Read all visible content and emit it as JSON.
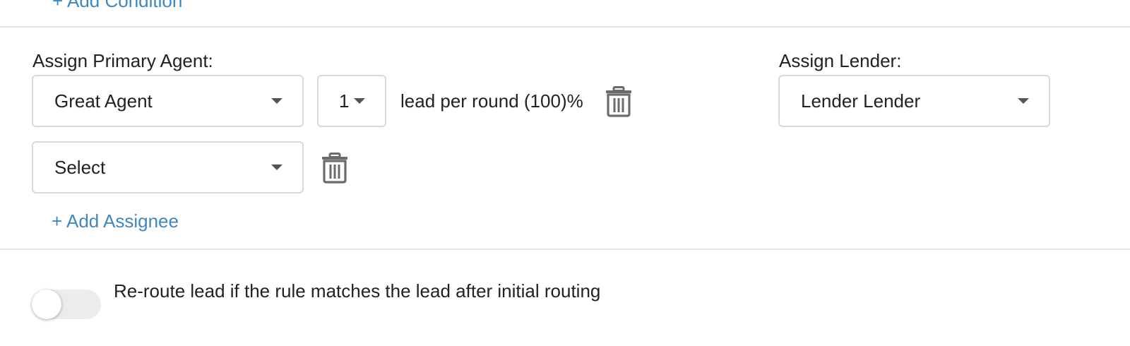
{
  "add_condition_label": "+ Add Condition",
  "primary_agent": {
    "label": "Assign Primary Agent:",
    "rows": [
      {
        "agent": "Great Agent",
        "count": "1",
        "ratio_text": "lead per round (100)%"
      },
      {
        "agent": "Select"
      }
    ],
    "add_assignee_label": "+ Add Assignee"
  },
  "lender": {
    "label": "Assign Lender:",
    "value": "Lender Lender"
  },
  "reroute": {
    "label": "Re-route lead if the rule matches the lead after initial routing",
    "enabled": false
  },
  "colors": {
    "link": "#3f87bf",
    "border": "#d9d9d9",
    "icon": "#6b6b6b",
    "toggle_off": "#ececec"
  },
  "icons": {
    "delete": "trash-icon",
    "dropdown": "caret-down-icon"
  }
}
